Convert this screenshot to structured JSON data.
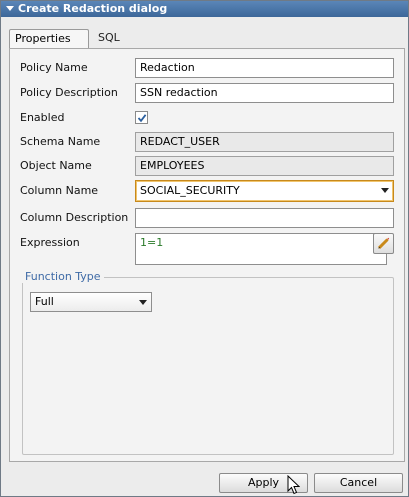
{
  "window": {
    "title": "Create Redaction dialog"
  },
  "tabs": [
    {
      "label": "Properties",
      "active": true
    },
    {
      "label": "SQL",
      "active": false
    }
  ],
  "form": {
    "policy_name": {
      "label": "Policy Name",
      "value": "Redaction"
    },
    "policy_description": {
      "label": "Policy Description",
      "value": "SSN redaction"
    },
    "enabled": {
      "label": "Enabled",
      "checked": true
    },
    "schema_name": {
      "label": "Schema Name",
      "value": "REDACT_USER"
    },
    "object_name": {
      "label": "Object Name",
      "value": "EMPLOYEES"
    },
    "column_name": {
      "label": "Column Name",
      "value": "SOCIAL_SECURITY"
    },
    "column_description": {
      "label": "Column Description",
      "value": ""
    },
    "expression": {
      "label": "Expression",
      "value": "1=1"
    }
  },
  "function_type": {
    "title": "Function Type",
    "value": "Full"
  },
  "buttons": {
    "apply": "Apply",
    "cancel": "Cancel"
  },
  "colors": {
    "titlebar": "#4a76aa",
    "group_title": "#3e6aa6",
    "expression_text": "#2a7a2a"
  }
}
